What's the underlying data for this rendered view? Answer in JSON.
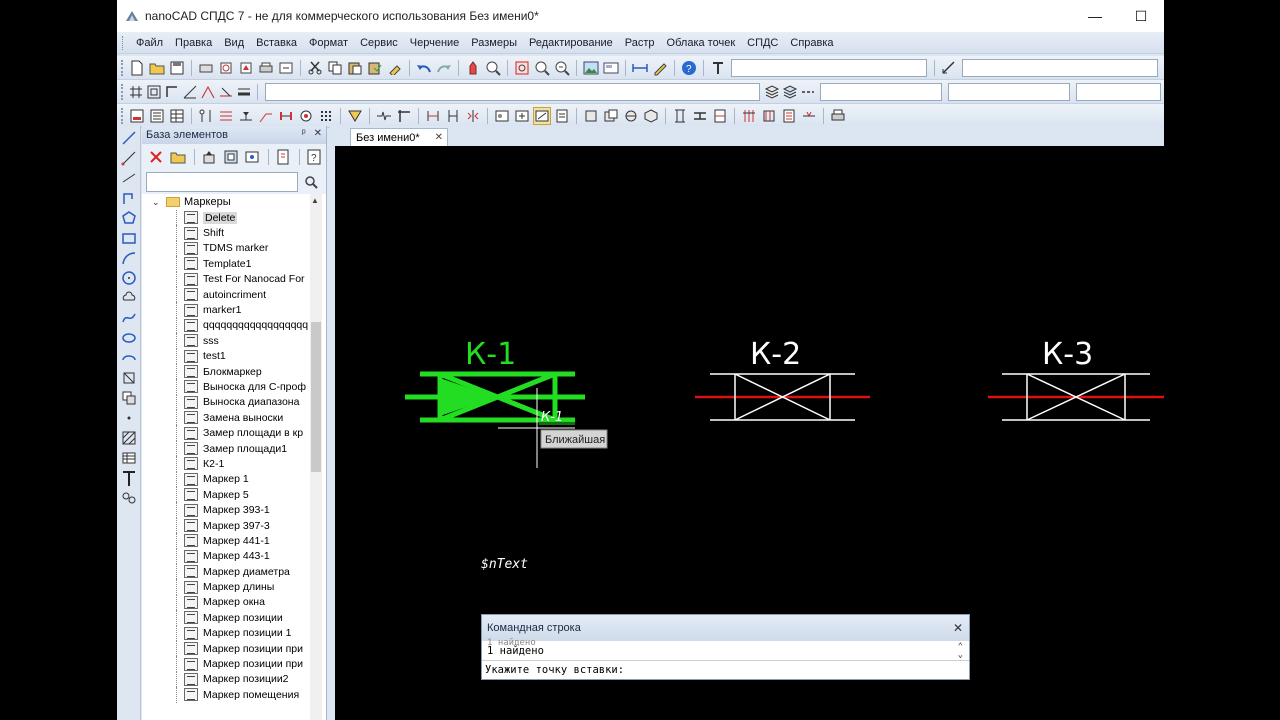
{
  "window": {
    "title": "nanoCAD СПДС 7 - не для коммерческого использования Без имени0*",
    "minimize": "—",
    "maximize": "☐"
  },
  "menu": [
    "Файл",
    "Правка",
    "Вид",
    "Вставка",
    "Формат",
    "Сервис",
    "Черчение",
    "Размеры",
    "Редактирование",
    "Растр",
    "Облака точек",
    "СПДС",
    "Справка"
  ],
  "panel": {
    "title": "База элементов",
    "pin": "ᵖ",
    "close": "✕",
    "search_value": "",
    "root_label": "Маркеры",
    "items": [
      "Delete",
      "Shift",
      "TDMS marker",
      "Template1",
      "Test For Nanocad For",
      "autoincriment",
      "marker1",
      "qqqqqqqqqqqqqqqqqq",
      "sss",
      "test1",
      "Блокмаркер",
      "Выноска для С-проф",
      "Выноска диапазона",
      "Замена выноски",
      "Замер площади в кр",
      "Замер площади1",
      "К2-1",
      "Маркер 1",
      "Маркер 5",
      "Маркер 393-1",
      "Маркер 397-3",
      "Маркер 441-1",
      "Маркер 443-1",
      "Маркер диаметра",
      "Маркер длины",
      "Маркер окна",
      "Маркер позиции",
      "Маркер позиции 1",
      "Маркер позиции при",
      "Маркер позиции при",
      "Маркер позиции2",
      "Маркер помещения"
    ],
    "selected_index": 0
  },
  "document": {
    "tab_label": "Без имени0*",
    "tab_close": "✕"
  },
  "drawing": {
    "labels": [
      "К-1",
      "К-2",
      "К-3"
    ],
    "cursor_label": "К-1",
    "snap_tooltip": "Ближайшая",
    "text_field": "$nText",
    "colors": {
      "highlight": "#22dd22",
      "symbol": "#ffffff",
      "axis": "#dd1111",
      "background": "#000000"
    }
  },
  "command_line": {
    "title": "Командная строка",
    "close": "✕",
    "prev_line": "1 найдено",
    "history": "1 найдено",
    "prompt": "Укажите точку вставки:"
  }
}
